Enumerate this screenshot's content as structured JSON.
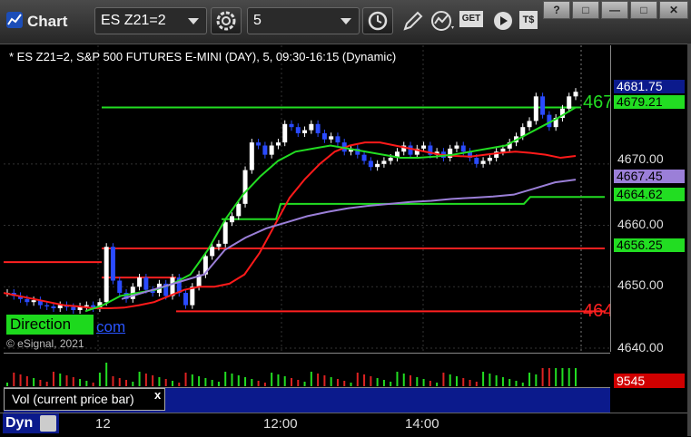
{
  "toolbar": {
    "title": "Chart",
    "symbol_value": "ES Z21=2",
    "interval_value": "5",
    "get_label": "GET",
    "ts_label": "T$",
    "window_help": "?",
    "window_restore": "□",
    "window_minimize": "—",
    "window_maximize": "□",
    "window_close": "✕"
  },
  "chart": {
    "header": "* ES Z21=2, S&P 500 FUTURES E-MINI (DAY), 5, 09:30-16:15 (Dynamic)",
    "copyright": "© eSignal, 2021",
    "direction_label": "Direction",
    "link_text": "com",
    "right_label_top": "467",
    "right_label_bottom": "464",
    "y_ticks": [
      "4670.00",
      "4660.00",
      "4650.00",
      "4640.00"
    ],
    "tags": [
      {
        "text": "4681.75",
        "bg": "#0b1a8c",
        "fg": "#ffffff"
      },
      {
        "text": "4679.21",
        "bg": "#22dd22",
        "fg": "#000000"
      },
      {
        "text": "4667.45",
        "bg": "#9b7fd8",
        "fg": "#000000"
      },
      {
        "text": "4664.62",
        "bg": "#22dd22",
        "fg": "#000000"
      },
      {
        "text": "4656.25",
        "bg": "#22dd22",
        "fg": "#000000"
      }
    ]
  },
  "volume": {
    "label": "Vol (current price bar)",
    "close": "x",
    "value": "9545"
  },
  "time_axis": {
    "ticks": [
      "12",
      "12:00",
      "14:00"
    ],
    "dyn_label": "Dyn"
  },
  "chart_data": {
    "type": "line",
    "title": "* ES Z21=2, S&P 500 FUTURES E-MINI (DAY), 5, 09:30-16:15 (Dynamic)",
    "ylim": [
      4640,
      4684
    ],
    "y_ticks": [
      4640,
      4650,
      4660,
      4670
    ],
    "x_ticks": [
      "12",
      "12:00",
      "14:00"
    ],
    "horizontal_levels": [
      4679.21,
      4664.62,
      4656.25,
      4646.0
    ],
    "last_price": 4681.75,
    "closes": [
      4649.0,
      4648.5,
      4648.0,
      4647.5,
      4647.8,
      4647.0,
      4646.8,
      4646.5,
      4647.0,
      4646.7,
      4646.2,
      4646.8,
      4647.0,
      4646.5,
      4647.5,
      4656.5,
      4651.0,
      4649.0,
      4648.0,
      4650.0,
      4651.5,
      4649.5,
      4649.0,
      4650.5,
      4648.5,
      4651.5,
      4649.0,
      4647.0,
      4650.0,
      4652.0,
      4655.0,
      4656.5,
      4657.0,
      4660.5,
      4661.5,
      4663.5,
      4669.0,
      4673.5,
      4673.0,
      4671.5,
      4673.0,
      4673.5,
      4676.5,
      4676.0,
      4675.0,
      4675.5,
      4676.5,
      4675.0,
      4674.0,
      4674.5,
      4673.5,
      4672.0,
      4672.5,
      4671.5,
      4670.5,
      4669.5,
      4670.0,
      4670.5,
      4671.0,
      4672.0,
      4673.0,
      4671.5,
      4672.5,
      4673.0,
      4671.5,
      4672.0,
      4671.0,
      4672.5,
      4673.0,
      4672.0,
      4671.0,
      4670.0,
      4670.5,
      4671.0,
      4672.0,
      4672.5,
      4673.5,
      4674.5,
      4676.0,
      4677.0,
      4681.0,
      4678.0,
      4676.0,
      4677.5,
      4679.0,
      4681.0,
      4681.75
    ],
    "series": [
      {
        "name": "",
        "color": "#ff1a1a",
        "values": [
          4649.0,
          4648.5,
          4648.0,
          4647.5,
          4647.0,
          4646.8,
          4646.5,
          4646.5,
          4646.6,
          4647.0,
          4647.5,
          4648.5,
          4649.5,
          4650.0,
          4650.0,
          4650.5,
          4652.0,
          4655.5,
          4660.0,
          4664.5,
          4667.5,
          4670.0,
          4672.0,
          4673.0,
          4673.5,
          4673.5,
          4673.0,
          4672.5,
          4672.0,
          4671.5,
          4671.3,
          4671.2,
          4671.5,
          4671.8,
          4672.0,
          4671.8,
          4671.5,
          4671.0,
          4671.3
        ]
      },
      {
        "name": "",
        "color": "#22dd22",
        "values": [
          4646.0,
          4647.0,
          4648.5,
          4649.0,
          4649.5,
          4650.5,
          4652.0,
          4656.0,
          4661.0,
          4665.0,
          4668.0,
          4670.5,
          4672.0,
          4672.5,
          4673.0,
          4672.5,
          4672.0,
          4671.5,
          4671.0,
          4671.0,
          4671.2,
          4671.5,
          4672.0,
          4672.5,
          4673.0,
          4674.5,
          4676.0,
          4677.5,
          4679.21
        ]
      },
      {
        "name": "",
        "color": "#9b7fd8",
        "values": [
          4648.0,
          4649.0,
          4650.0,
          4651.0,
          4652.0,
          4656.0,
          4658.0,
          4659.5,
          4660.5,
          4661.5,
          4662.2,
          4662.8,
          4663.2,
          4663.5,
          4663.8,
          4664.0,
          4664.3,
          4664.5,
          4664.7,
          4665.0,
          4666.0,
          4667.0,
          4667.45
        ]
      }
    ]
  }
}
